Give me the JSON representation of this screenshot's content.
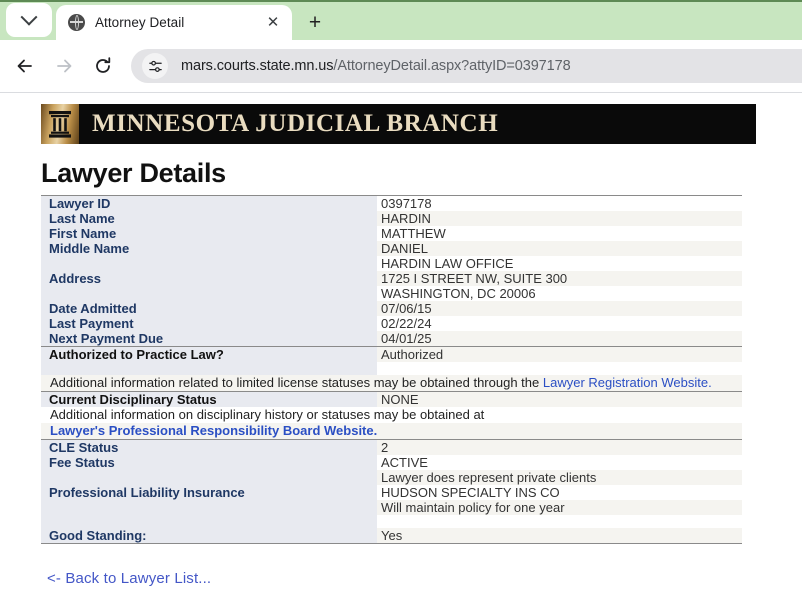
{
  "browser": {
    "tab": {
      "title": "Attorney Detail",
      "favicon_name": "globe-icon",
      "close_label": "✕"
    },
    "newtab_label": "+",
    "tab_list_label": "",
    "nav": {
      "back_label": "",
      "forward_label": "",
      "reload_label": ""
    },
    "omnibox": {
      "url_host": "mars.courts.state.mn.us",
      "url_path": "/AttorneyDetail.aspx?attyID=0397178",
      "full_url": "mars.courts.state.mn.us/AttorneyDetail.aspx?attyID=0397178",
      "site_settings_icon": "tune-icon"
    }
  },
  "site": {
    "banner_title": "MINNESOTA JUDICIAL BRANCH",
    "logo_name": "judicial-column-icon",
    "banner_bg": "#0a0a0a",
    "banner_text_color": "#e9dcc0"
  },
  "page": {
    "title": "Lawyer Details",
    "back_link": "<- Back to Lawyer List..."
  },
  "details": {
    "rows": [
      {
        "label": "Lawyer ID",
        "value": "0397178"
      },
      {
        "label": "Last Name",
        "value": "HARDIN"
      },
      {
        "label": "First Name",
        "value": "MATTHEW"
      },
      {
        "label": "Middle Name",
        "value": "DANIEL"
      },
      {
        "label": "Address",
        "value_lines": [
          "HARDIN LAW OFFICE",
          "1725 I STREET NW, SUITE 300",
          "WASHINGTON, DC  20006"
        ]
      },
      {
        "label": "Date Admitted",
        "value": "07/06/15"
      },
      {
        "label": "Last Payment",
        "value": "02/22/24"
      },
      {
        "label": "Next Payment Due",
        "value": "04/01/25"
      },
      {
        "label": "Authorized to Practice Law?",
        "value": "Authorized",
        "value_color": "green"
      },
      {
        "label": "Current Disciplinary Status",
        "value": "NONE"
      },
      {
        "label": "CLE Status",
        "value": "2"
      },
      {
        "label": "Fee Status",
        "value": "ACTIVE"
      },
      {
        "label": "Professional Liability Insurance",
        "value_lines": [
          "Lawyer does represent private clients",
          "HUDSON SPECIALTY INS CO",
          "Will maintain policy for one year"
        ]
      },
      {
        "label": "Good Standing:",
        "value": "Yes"
      }
    ],
    "note_limited_license": {
      "text_before": "Additional information related to limited license statuses may be obtained through the ",
      "link_text": "Lawyer Registration Website."
    },
    "note_disciplinary": {
      "text_before": "Additional information on disciplinary history or statuses may be obtained at",
      "link_text": "Lawyer's Professional Responsibility Board Website."
    }
  },
  "colors": {
    "label_blue": "#1f3864",
    "link_blue": "#2b4fc4",
    "status_green": "#1e7a34",
    "label_bg": "#e8eaf0",
    "value_alt_bg": "#f5f4f0",
    "tabstrip_green": "#c8e6c0"
  }
}
